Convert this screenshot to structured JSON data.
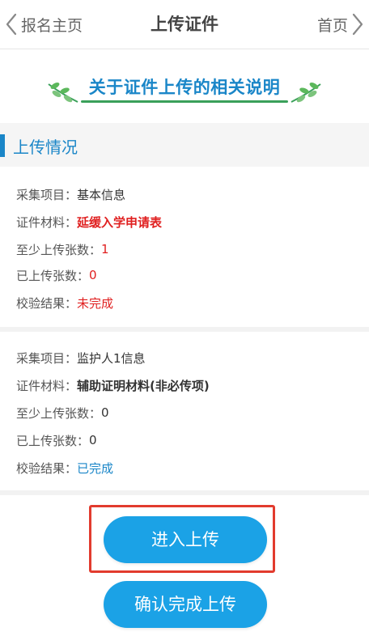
{
  "nav": {
    "back_label": "报名主页",
    "title": "上传证件",
    "home_label": "首页"
  },
  "banner": {
    "title": "关于证件上传的相关说明"
  },
  "section": {
    "title": "上传情况"
  },
  "items": [
    {
      "project_key": "采集项目：",
      "project_value": "基本信息",
      "material_key": "证件材料：",
      "material_value": "延缓入学申请表",
      "min_key": "至少上传张数：",
      "min_value": "1",
      "uploaded_key": "已上传张数：",
      "uploaded_value": "0",
      "check_key": "校验结果：",
      "check_value": "未完成"
    },
    {
      "project_key": "采集项目：",
      "project_value": "监护人1信息",
      "material_key": "证件材料：",
      "material_value": "辅助证明材料(非必传项)",
      "min_key": "至少上传张数：",
      "min_value": "0",
      "uploaded_key": "已上传张数：",
      "uploaded_value": "0",
      "check_key": "校验结果：",
      "check_value": "已完成"
    }
  ],
  "buttons": {
    "upload": "进入上传",
    "confirm": "确认完成上传"
  },
  "colors": {
    "accent": "#1a86c8",
    "button": "#1ba2e6",
    "error": "#e02020",
    "highlight": "#e23b2e",
    "leaf": "#3aa05a"
  },
  "icons": {
    "back": "chevron-left-icon",
    "home": "chevron-right-icon",
    "leaf": "leaf-branch-icon"
  }
}
